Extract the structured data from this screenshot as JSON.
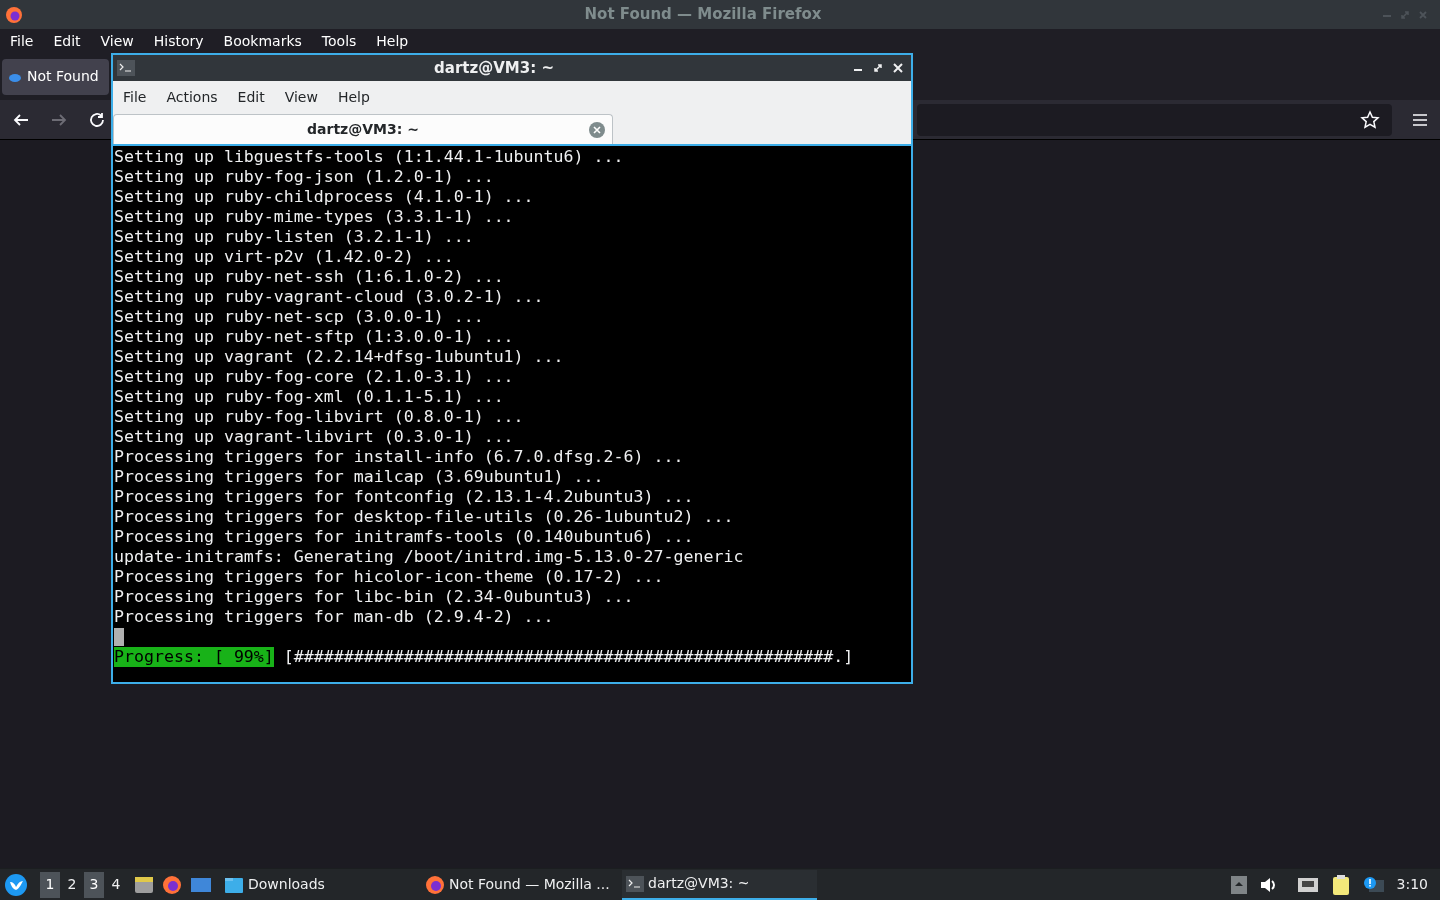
{
  "browser": {
    "title": "Not Found — Mozilla Firefox",
    "menu": [
      "File",
      "Edit",
      "View",
      "History",
      "Bookmarks",
      "Tools",
      "Help"
    ],
    "tab": {
      "label": "Not Found"
    }
  },
  "terminal": {
    "title": "dartz@VM3: ~",
    "menu": [
      "File",
      "Actions",
      "Edit",
      "View",
      "Help"
    ],
    "tab": {
      "label": "dartz@VM3: ~"
    },
    "lines": [
      "Setting up libguestfs-tools (1:1.44.1-1ubuntu6) ...",
      "Setting up ruby-fog-json (1.2.0-1) ...",
      "Setting up ruby-childprocess (4.1.0-1) ...",
      "Setting up ruby-mime-types (3.3.1-1) ...",
      "Setting up ruby-listen (3.2.1-1) ...",
      "Setting up virt-p2v (1.42.0-2) ...",
      "Setting up ruby-net-ssh (1:6.1.0-2) ...",
      "Setting up ruby-vagrant-cloud (3.0.2-1) ...",
      "Setting up ruby-net-scp (3.0.0-1) ...",
      "Setting up ruby-net-sftp (1:3.0.0-1) ...",
      "Setting up vagrant (2.2.14+dfsg-1ubuntu1) ...",
      "Setting up ruby-fog-core (2.1.0-3.1) ...",
      "Setting up ruby-fog-xml (0.1.1-5.1) ...",
      "Setting up ruby-fog-libvirt (0.8.0-1) ...",
      "Setting up vagrant-libvirt (0.3.0-1) ...",
      "Processing triggers for install-info (6.7.0.dfsg.2-6) ...",
      "Processing triggers for mailcap (3.69ubuntu1) ...",
      "Processing triggers for fontconfig (2.13.1-4.2ubuntu3) ...",
      "Processing triggers for desktop-file-utils (0.26-1ubuntu2) ...",
      "Processing triggers for initramfs-tools (0.140ubuntu6) ...",
      "update-initramfs: Generating /boot/initrd.img-5.13.0-27-generic",
      "Processing triggers for hicolor-icon-theme (0.17-2) ...",
      "Processing triggers for libc-bin (2.34-0ubuntu3) ...",
      "Processing triggers for man-db (2.9.4-2) ..."
    ],
    "progress_label": "Progress: [ 99%]",
    "progress_bar": "[######################################################.]"
  },
  "taskbar": {
    "workspaces": [
      {
        "label": "1",
        "selected": true
      },
      {
        "label": "2",
        "selected": false
      },
      {
        "label": "3",
        "selected": true
      },
      {
        "label": "4",
        "selected": false
      }
    ],
    "tasks": [
      {
        "kind": "folder",
        "label": "Downloads",
        "selected": false
      },
      {
        "kind": "firefox",
        "label": "Not Found — Mozilla ...",
        "selected": false
      },
      {
        "kind": "terminal",
        "label": "dartz@VM3: ~",
        "selected": true
      }
    ],
    "clock": "3:10"
  }
}
